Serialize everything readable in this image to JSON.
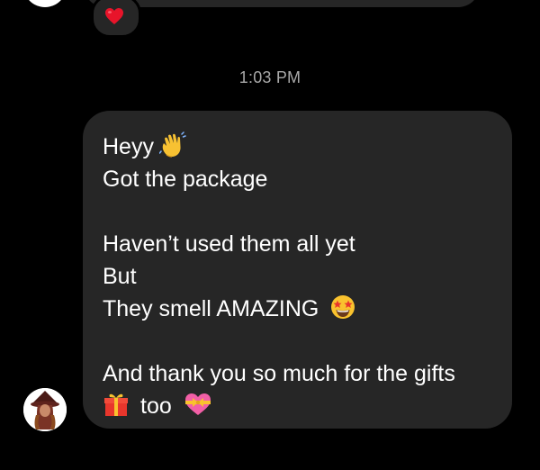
{
  "previous_message": {
    "reaction_emoji_name": "red-heart"
  },
  "timestamp": "1:03 PM",
  "message": {
    "lines": [
      "Heyy",
      "Got the package",
      "",
      "Haven’t used them all yet",
      "But",
      "They smell AMAZING",
      "",
      "And thank you so much for the gifts",
      "too"
    ],
    "emojis": {
      "line_1": "waving-hand",
      "line_6": "star-struck-face",
      "line_9_before": "wrapped-gift",
      "line_9_after": "heart-with-ribbon"
    }
  },
  "colors": {
    "background": "#000000",
    "bubble": "#262626",
    "text": "#ffffff",
    "timestamp": "#a8a8a8"
  }
}
